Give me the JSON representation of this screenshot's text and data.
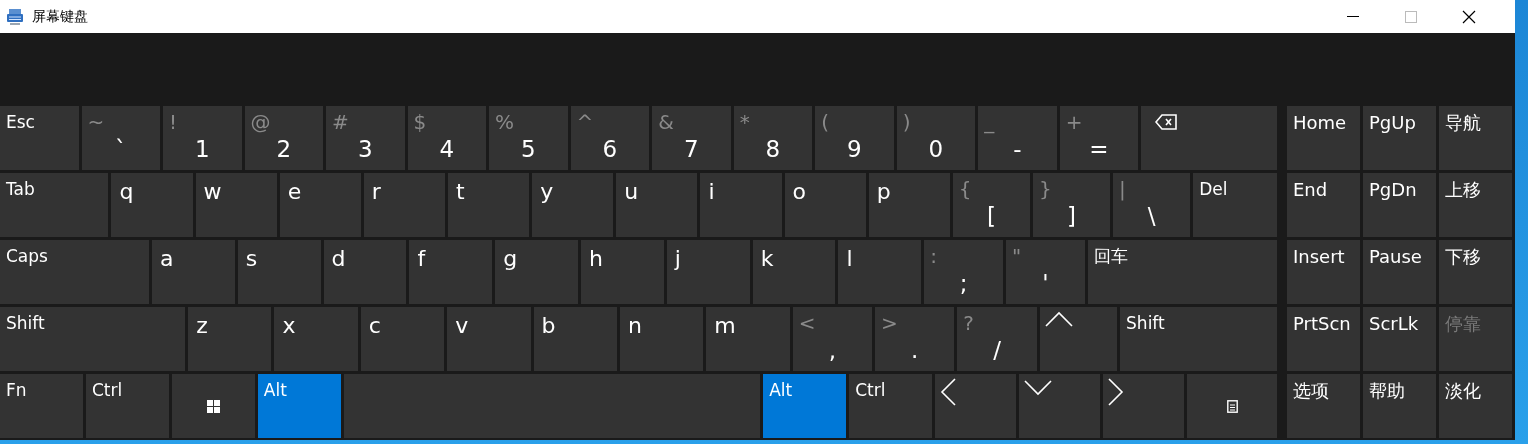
{
  "window": {
    "title": "屏幕键盘"
  },
  "rows": [
    {
      "keys": [
        {
          "kind": "text",
          "label": "Esc",
          "on": false
        },
        {
          "kind": "dual",
          "shift": "~",
          "label": "`",
          "on": false
        },
        {
          "kind": "dual",
          "shift": "!",
          "label": "1",
          "on": false
        },
        {
          "kind": "dual",
          "shift": "@",
          "label": "2",
          "on": false
        },
        {
          "kind": "dual",
          "shift": "#",
          "label": "3",
          "on": false
        },
        {
          "kind": "dual",
          "shift": "$",
          "label": "4",
          "on": false
        },
        {
          "kind": "dual",
          "shift": "%",
          "label": "5",
          "on": false
        },
        {
          "kind": "dual",
          "shift": "^",
          "label": "6",
          "on": false
        },
        {
          "kind": "dual",
          "shift": "&",
          "label": "7",
          "on": false
        },
        {
          "kind": "dual",
          "shift": "*",
          "label": "8",
          "on": false
        },
        {
          "kind": "dual",
          "shift": "(",
          "label": "9",
          "on": false
        },
        {
          "kind": "dual",
          "shift": ")",
          "label": "0",
          "on": false
        },
        {
          "kind": "dual",
          "shift": "_",
          "label": "-",
          "on": false
        },
        {
          "kind": "dual",
          "shift": "+",
          "label": "=",
          "on": false
        },
        {
          "kind": "backspace",
          "on": false
        }
      ]
    },
    {
      "keys": [
        {
          "kind": "text",
          "label": "Tab",
          "on": false
        },
        {
          "kind": "letter",
          "label": "q",
          "on": false
        },
        {
          "kind": "letter",
          "label": "w",
          "on": false
        },
        {
          "kind": "letter",
          "label": "e",
          "on": false
        },
        {
          "kind": "letter",
          "label": "r",
          "on": false
        },
        {
          "kind": "letter",
          "label": "t",
          "on": false
        },
        {
          "kind": "letter",
          "label": "y",
          "on": false
        },
        {
          "kind": "letter",
          "label": "u",
          "on": false
        },
        {
          "kind": "letter",
          "label": "i",
          "on": false
        },
        {
          "kind": "letter",
          "label": "o",
          "on": false
        },
        {
          "kind": "letter",
          "label": "p",
          "on": false
        },
        {
          "kind": "dual",
          "shift": "{",
          "label": "[",
          "on": false
        },
        {
          "kind": "dual",
          "shift": "}",
          "label": "]",
          "on": false
        },
        {
          "kind": "dual",
          "shift": "|",
          "label": "\\",
          "on": false
        },
        {
          "kind": "text",
          "label": "Del",
          "on": false
        }
      ]
    },
    {
      "keys": [
        {
          "kind": "text",
          "label": "Caps",
          "on": false
        },
        {
          "kind": "letter",
          "label": "a",
          "on": false
        },
        {
          "kind": "letter",
          "label": "s",
          "on": false
        },
        {
          "kind": "letter",
          "label": "d",
          "on": false
        },
        {
          "kind": "letter",
          "label": "f",
          "on": false
        },
        {
          "kind": "letter",
          "label": "g",
          "on": false
        },
        {
          "kind": "letter",
          "label": "h",
          "on": false
        },
        {
          "kind": "letter",
          "label": "j",
          "on": false
        },
        {
          "kind": "letter",
          "label": "k",
          "on": false
        },
        {
          "kind": "letter",
          "label": "l",
          "on": false
        },
        {
          "kind": "dual",
          "shift": ":",
          "label": ";",
          "on": false
        },
        {
          "kind": "dual",
          "shift": "\"",
          "label": "'",
          "on": false
        },
        {
          "kind": "text",
          "label": "回车",
          "on": false
        }
      ]
    },
    {
      "keys": [
        {
          "kind": "text",
          "label": "Shift",
          "on": false
        },
        {
          "kind": "letter",
          "label": "z",
          "on": false
        },
        {
          "kind": "letter",
          "label": "x",
          "on": false
        },
        {
          "kind": "letter",
          "label": "c",
          "on": false
        },
        {
          "kind": "letter",
          "label": "v",
          "on": false
        },
        {
          "kind": "letter",
          "label": "b",
          "on": false
        },
        {
          "kind": "letter",
          "label": "n",
          "on": false
        },
        {
          "kind": "letter",
          "label": "m",
          "on": false
        },
        {
          "kind": "dual",
          "shift": "<",
          "label": ",",
          "on": false
        },
        {
          "kind": "dual",
          "shift": ">",
          "label": ".",
          "on": false
        },
        {
          "kind": "dual",
          "shift": "?",
          "label": "/",
          "on": false
        },
        {
          "kind": "up",
          "on": false
        },
        {
          "kind": "text",
          "label": "Shift",
          "on": false
        }
      ]
    },
    {
      "keys": [
        {
          "kind": "text",
          "label": "Fn",
          "on": false
        },
        {
          "kind": "text",
          "label": "Ctrl",
          "on": false
        },
        {
          "kind": "windows",
          "on": false
        },
        {
          "kind": "text",
          "label": "Alt",
          "on": true
        },
        {
          "kind": "space",
          "on": false
        },
        {
          "kind": "text",
          "label": "Alt",
          "on": true
        },
        {
          "kind": "text",
          "label": "Ctrl",
          "on": false
        },
        {
          "kind": "left",
          "on": false
        },
        {
          "kind": "down",
          "on": false
        },
        {
          "kind": "right",
          "on": false
        },
        {
          "kind": "menu",
          "on": false
        }
      ]
    }
  ],
  "nav": [
    {
      "label": "Home",
      "disabled": false
    },
    {
      "label": "PgUp",
      "disabled": false
    },
    {
      "label": "导航",
      "disabled": false
    },
    {
      "label": "End",
      "disabled": false
    },
    {
      "label": "PgDn",
      "disabled": false
    },
    {
      "label": "上移",
      "disabled": false
    },
    {
      "label": "Insert",
      "disabled": false
    },
    {
      "label": "Pause",
      "disabled": false
    },
    {
      "label": "下移",
      "disabled": false
    },
    {
      "label": "PrtScn",
      "disabled": false
    },
    {
      "label": "ScrLk",
      "disabled": false
    },
    {
      "label": "停靠",
      "disabled": true
    },
    {
      "label": "选项",
      "disabled": false
    },
    {
      "label": "帮助",
      "disabled": false
    },
    {
      "label": "淡化",
      "disabled": false
    }
  ]
}
